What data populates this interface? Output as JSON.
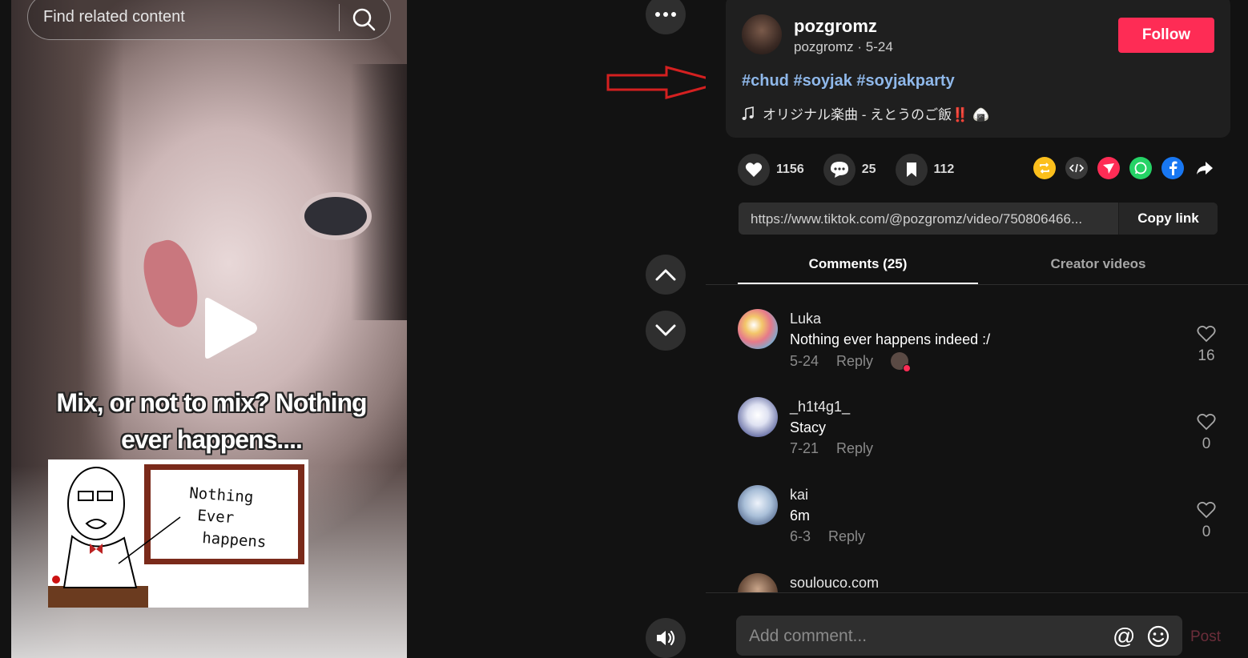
{
  "search": {
    "placeholder": "Find related content"
  },
  "video": {
    "caption_line1": "Mix, or not to mix? Nothing",
    "caption_line2": "ever happens....",
    "meme_text": [
      "Nothing",
      "Ever",
      "happens"
    ]
  },
  "post": {
    "author": "pozgromz",
    "author_sub": "pozgromz · 5-24",
    "follow_label": "Follow",
    "hashtags": "#chud #soyjak #soyjakparty",
    "music": "オリジナル楽曲 - えとうのご飯‼️ 🍙"
  },
  "stats": {
    "likes": "1156",
    "comments": "25",
    "saves": "112"
  },
  "share": {
    "url": "https://www.tiktok.com/@pozgromz/video/750806466...",
    "copy_label": "Copy link"
  },
  "tabs": {
    "comments": "Comments (25)",
    "creator": "Creator videos"
  },
  "comments": [
    {
      "user": "Luka",
      "text": "Nothing ever happens indeed :/",
      "date": "5-24",
      "reply": "Reply",
      "likes": "16",
      "color": "#6cb3d8"
    },
    {
      "user": "_h1t4g1_",
      "text": "Stacy",
      "date": "7-21",
      "reply": "Reply",
      "likes": "0",
      "color": "#8790b8"
    },
    {
      "user": "kai",
      "text": "6m",
      "date": "6-3",
      "reply": "Reply",
      "likes": "0",
      "color": "#a9bfd8"
    },
    {
      "user": "soulouco.com",
      "text": "",
      "date": "",
      "reply": "",
      "likes": "",
      "color": "#5a4a40"
    }
  ],
  "composer": {
    "placeholder": "Add comment...",
    "at": "@",
    "post_label": "Post"
  },
  "colors": {
    "accent": "#fe2c55",
    "hashtag": "#8fb8ea",
    "panel": "#1f1f1f",
    "bg": "#121212"
  }
}
